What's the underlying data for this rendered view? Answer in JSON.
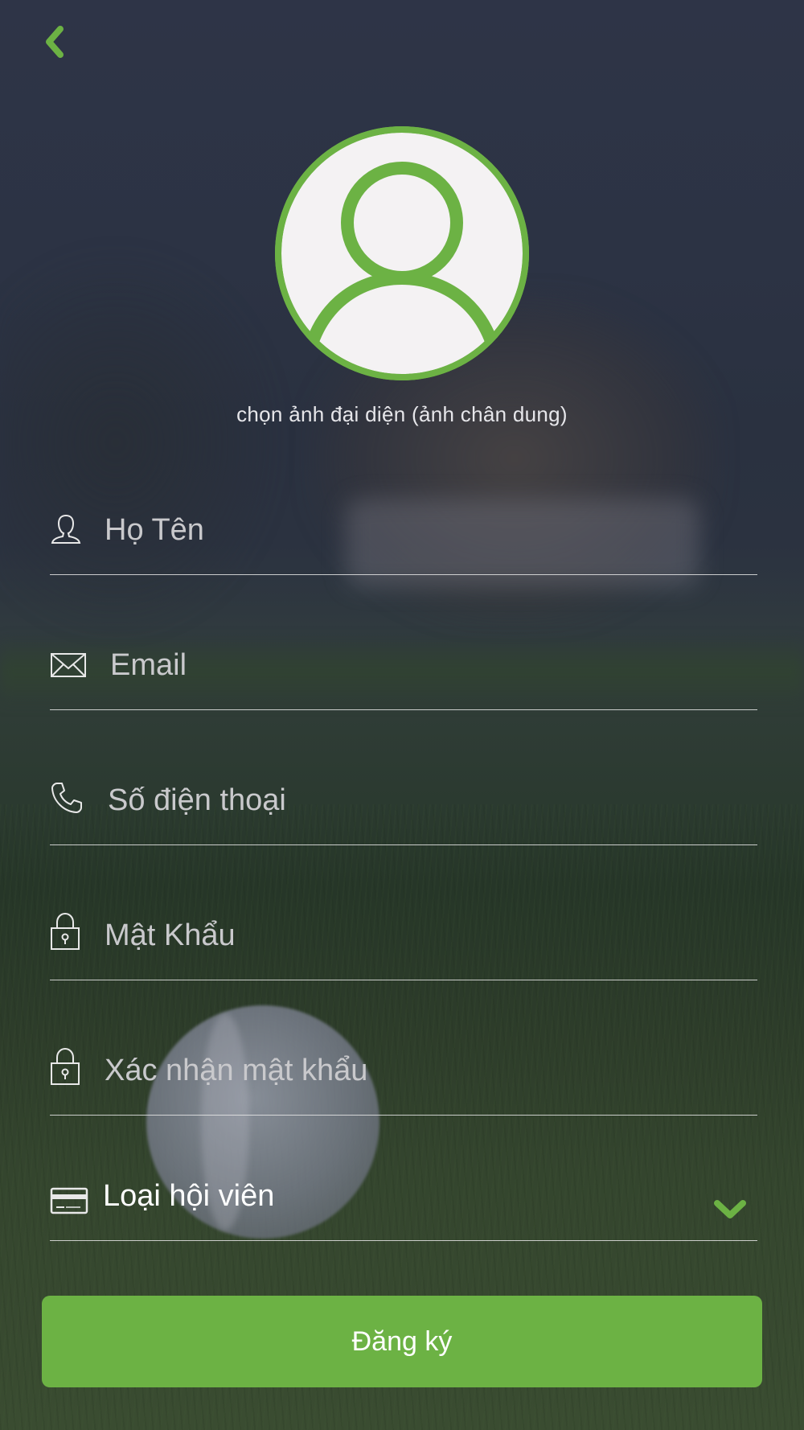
{
  "header": {
    "back_icon": "chevron-left-icon"
  },
  "avatar": {
    "icon": "user-avatar-icon",
    "caption": "chọn ảnh đại diện (ảnh chân dung)"
  },
  "form": {
    "name": {
      "icon": "person-icon",
      "placeholder": "Họ Tên"
    },
    "email": {
      "icon": "envelope-icon",
      "placeholder": "Email"
    },
    "phone": {
      "icon": "phone-icon",
      "placeholder": "Số điện thoại"
    },
    "password": {
      "icon": "lock-icon",
      "placeholder": "Mật Khẩu"
    },
    "confirm_password": {
      "icon": "lock-icon",
      "placeholder": "Xác nhận mật khẩu"
    },
    "membership": {
      "icon": "card-icon",
      "value": "Loại hội viên",
      "arrow_icon": "chevron-down-icon"
    }
  },
  "submit": {
    "label": "Đăng ký"
  },
  "colors": {
    "accent": "#6cb244",
    "avatar_bg": "#f4f2f3",
    "text_placeholder": "#c9c9cc",
    "divider": "#e6e6e6"
  }
}
